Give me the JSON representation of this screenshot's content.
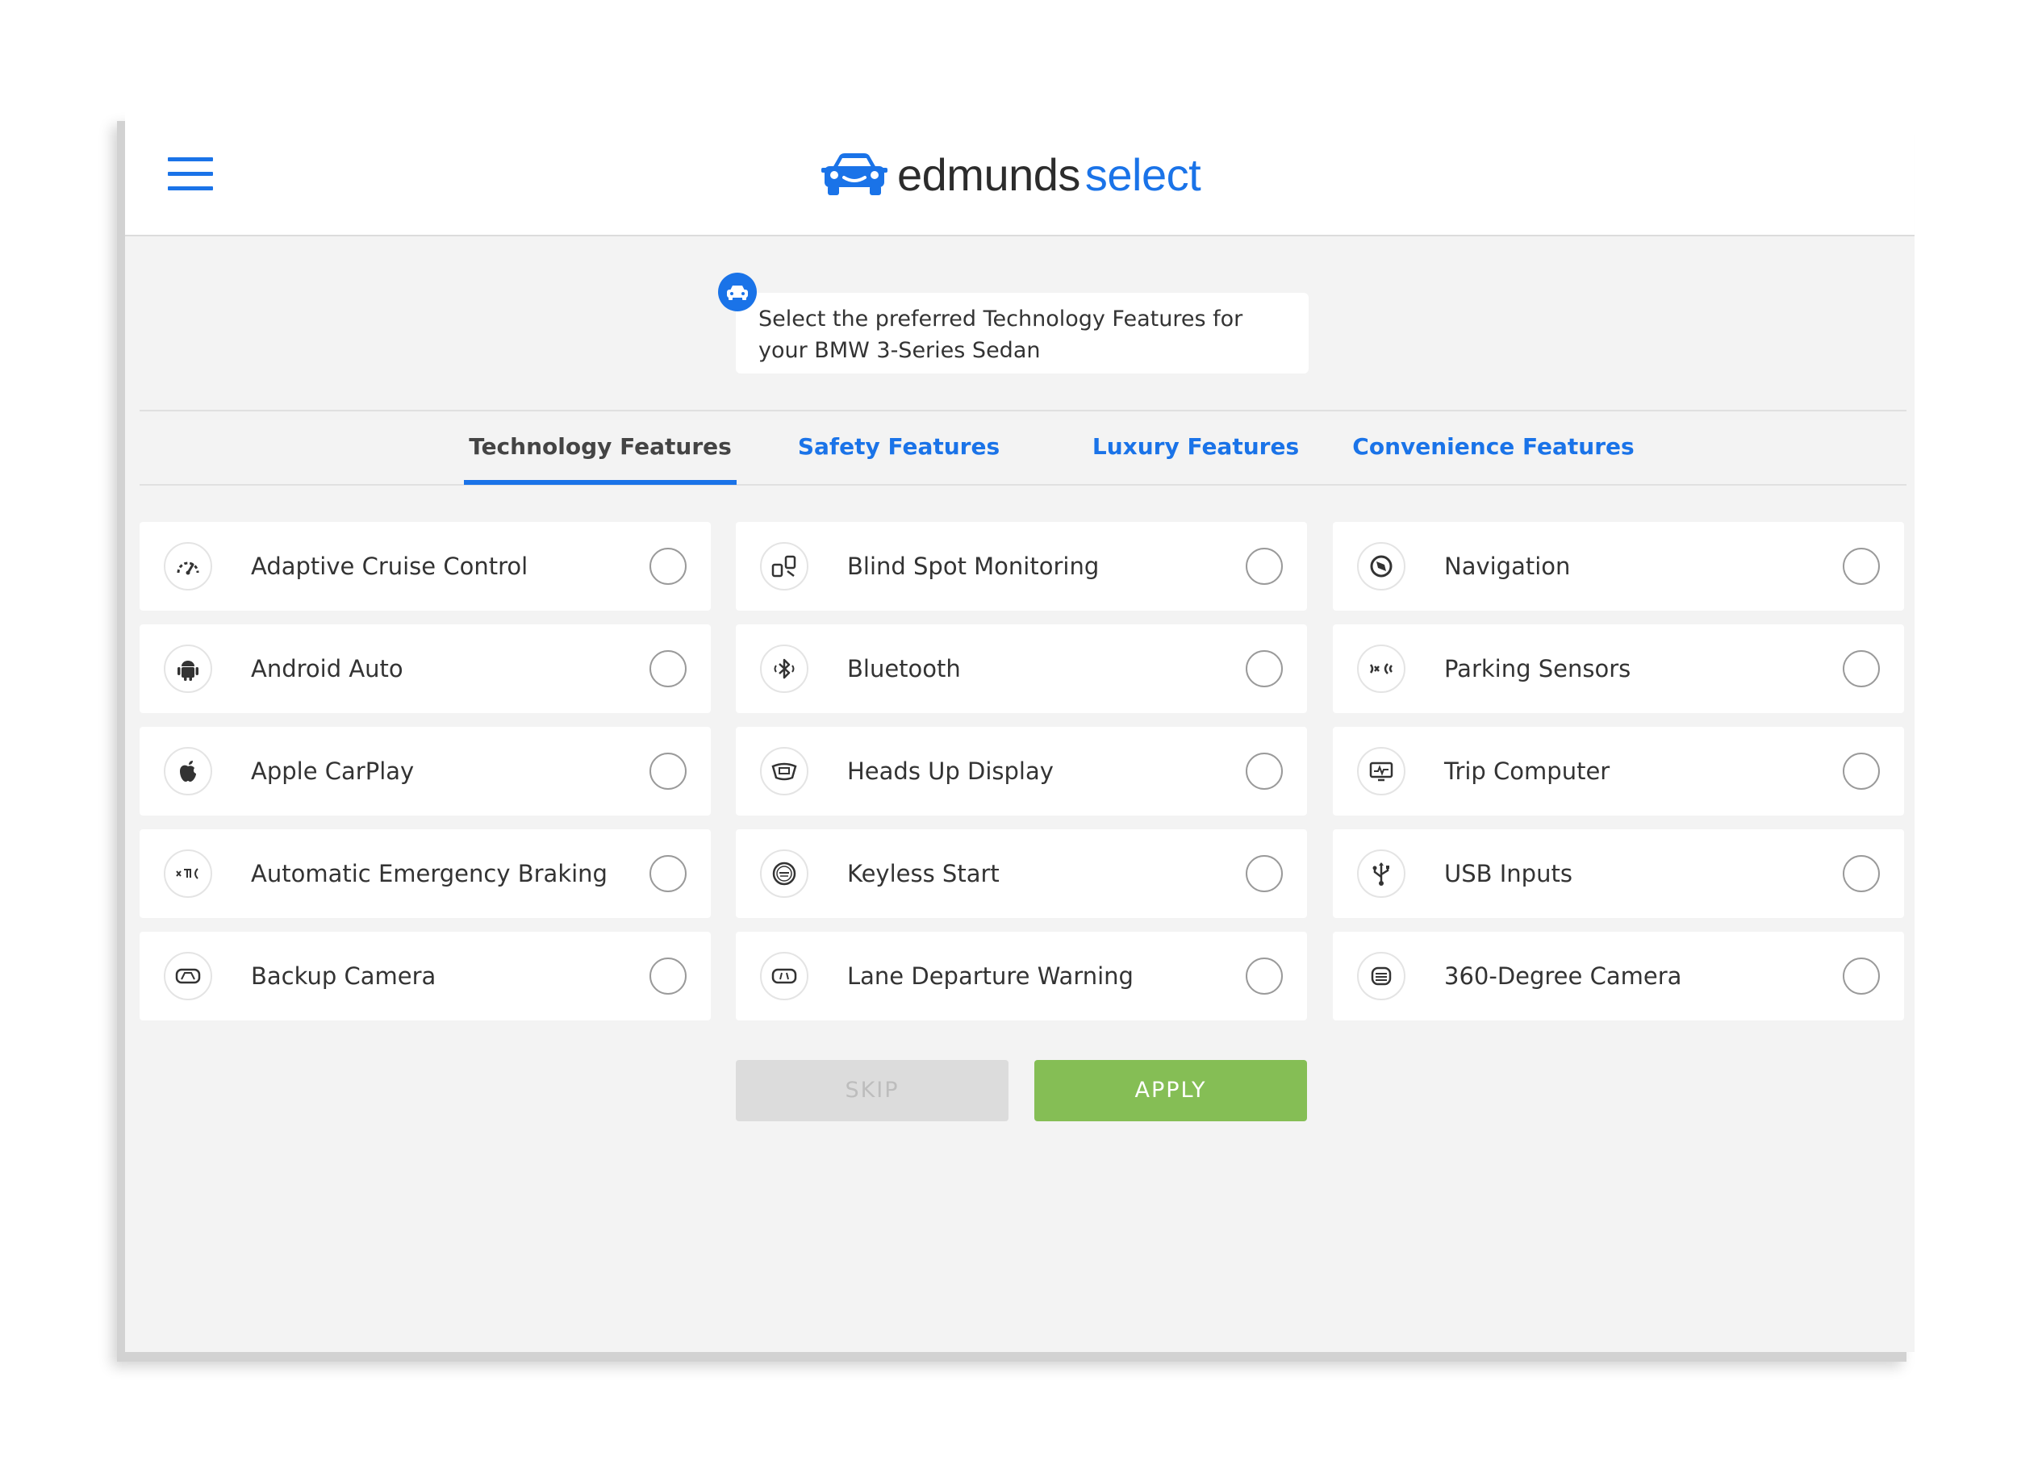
{
  "app": {
    "logo_primary": "edmunds",
    "logo_secondary": "select",
    "brand_color": "#1a73e8"
  },
  "prompt": {
    "text": "Select the preferred Technology Features for your BMW 3-Series Sedan"
  },
  "tabs": [
    {
      "label": "Technology Features",
      "active": true
    },
    {
      "label": "Safety Features",
      "active": false
    },
    {
      "label": "Luxury Features",
      "active": false
    },
    {
      "label": "Convenience Features",
      "active": false
    }
  ],
  "features": [
    {
      "label": "Adaptive Cruise Control",
      "icon": "speedometer-icon",
      "selected": false
    },
    {
      "label": "Blind Spot Monitoring",
      "icon": "blind-spot-icon",
      "selected": false
    },
    {
      "label": "Navigation",
      "icon": "compass-icon",
      "selected": false
    },
    {
      "label": "Android Auto",
      "icon": "android-icon",
      "selected": false
    },
    {
      "label": "Bluetooth",
      "icon": "bluetooth-icon",
      "selected": false
    },
    {
      "label": "Parking Sensors",
      "icon": "parking-sensor-icon",
      "selected": false
    },
    {
      "label": "Apple CarPlay",
      "icon": "apple-icon",
      "selected": false
    },
    {
      "label": "Heads Up Display",
      "icon": "heads-up-display-icon",
      "selected": false
    },
    {
      "label": "Trip Computer",
      "icon": "trip-computer-icon",
      "selected": false
    },
    {
      "label": "Automatic Emergency Braking",
      "icon": "emergency-braking-icon",
      "selected": false
    },
    {
      "label": "Keyless Start",
      "icon": "keyless-start-icon",
      "selected": false
    },
    {
      "label": "USB Inputs",
      "icon": "usb-icon",
      "selected": false
    },
    {
      "label": "Backup Camera",
      "icon": "backup-camera-icon",
      "selected": false
    },
    {
      "label": "Lane Departure Warning",
      "icon": "lane-departure-icon",
      "selected": false
    },
    {
      "label": "360-Degree Camera",
      "icon": "camera-360-icon",
      "selected": false
    }
  ],
  "actions": {
    "skip_label": "SKIP",
    "apply_label": "APPLY",
    "apply_color": "#85be55"
  }
}
